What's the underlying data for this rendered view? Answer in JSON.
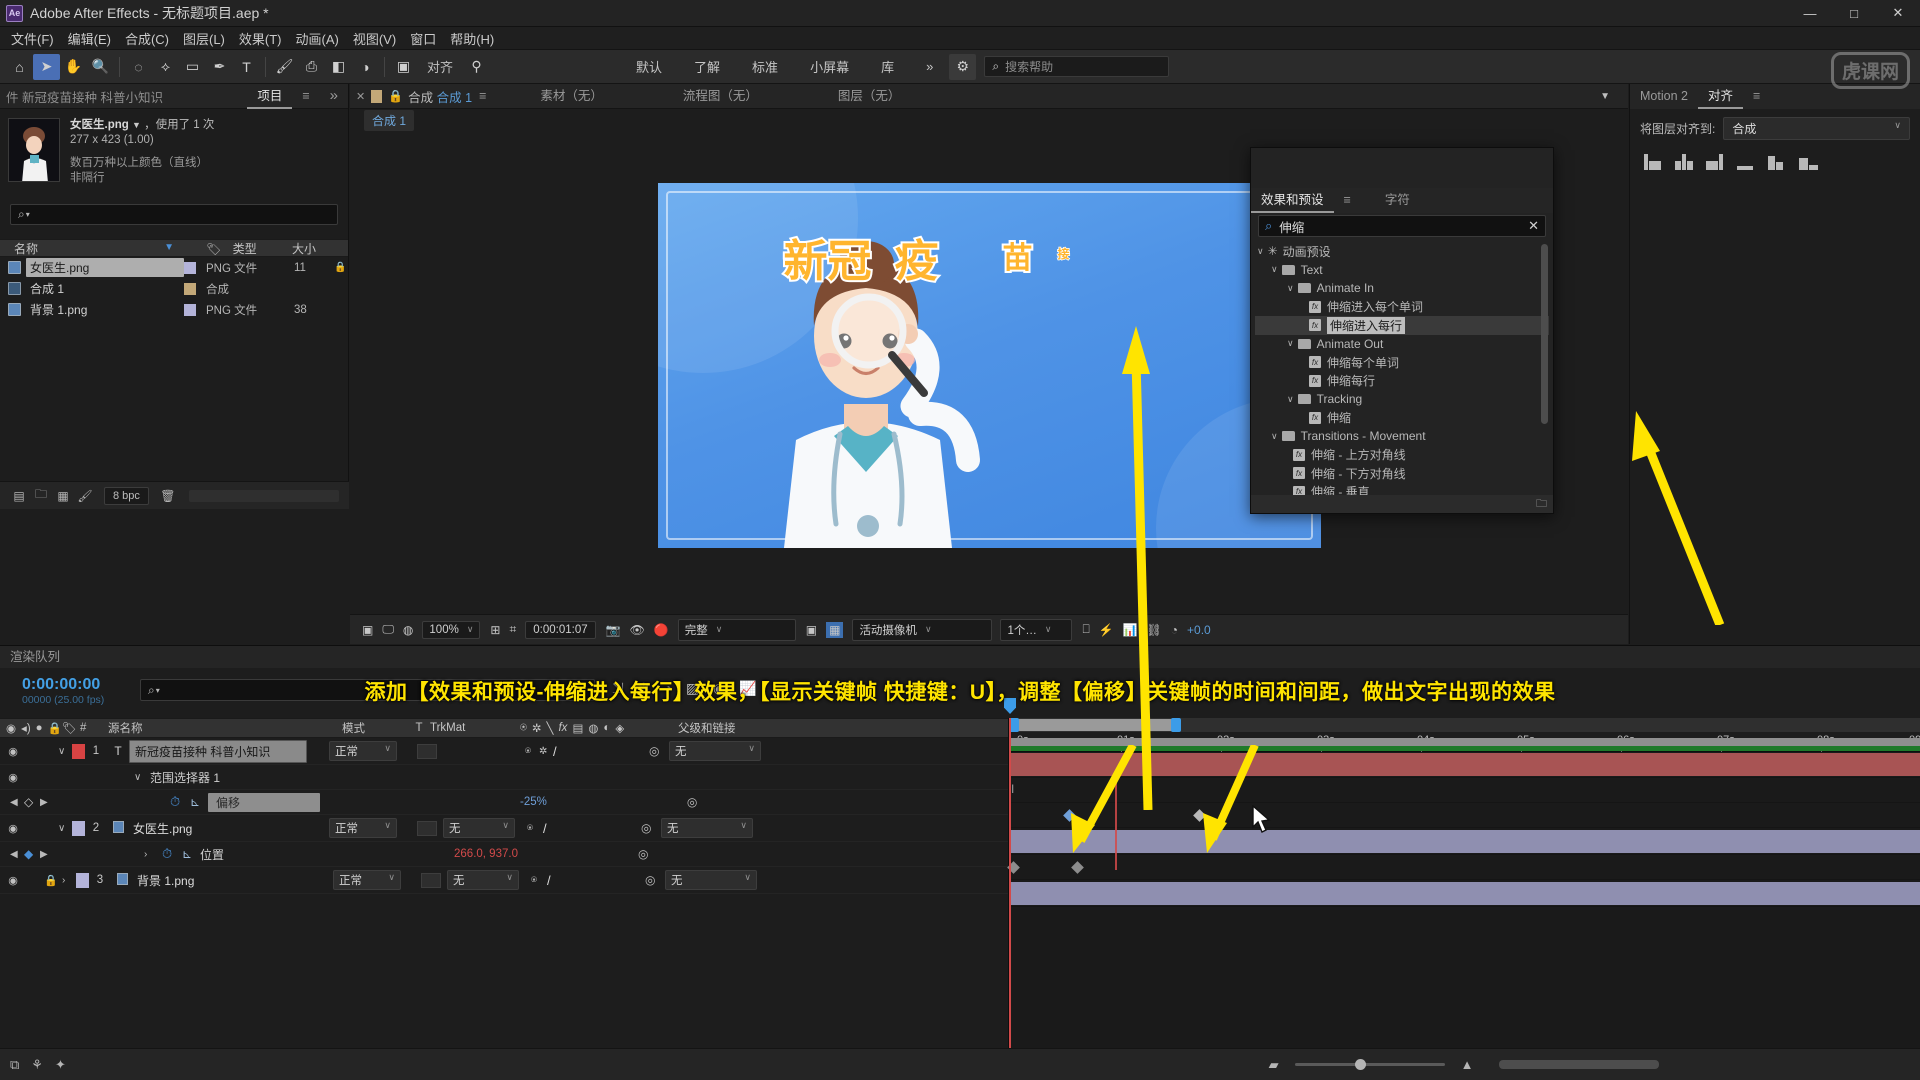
{
  "titlebar": {
    "logo": "Ae",
    "title": "Adobe After Effects - 无标题项目.aep *",
    "minimize": "—",
    "maximize": "□",
    "close": "✕"
  },
  "menubar": {
    "items": [
      "文件(F)",
      "编辑(E)",
      "合成(C)",
      "图层(L)",
      "效果(T)",
      "动画(A)",
      "视图(V)",
      "窗口",
      "帮助(H)"
    ]
  },
  "toolbar": {
    "align_label": "对齐",
    "workspaces": [
      "默认",
      "了解",
      "标准",
      "小屏幕",
      "库"
    ],
    "overflow": "»",
    "help_placeholder": "搜索帮助"
  },
  "project": {
    "tab_inactive": "件 新冠疫苗接种 科普小知识",
    "tab_active": "项目",
    "menu_icon": "≡",
    "expand_icon": "»",
    "selected_item": {
      "filename": "女医生.png",
      "used_text": "，使用了 1 次",
      "dimensions": "277 x 423 (1.00)",
      "color_depth": "数百万种以上颜色（直线）",
      "interlace": "非隔行"
    },
    "search_placeholder": "",
    "columns": [
      "名称",
      "类型",
      "大小"
    ],
    "files": [
      {
        "name": "女医生.png",
        "type": "PNG 文件",
        "size": "11",
        "swatch": "#b3b3d9",
        "kind": "image",
        "selected": true
      },
      {
        "name": "合成 1",
        "type": "合成",
        "size": "",
        "swatch": "#c3a878",
        "kind": "comp",
        "selected": false
      },
      {
        "name": "背景 1.png",
        "type": "PNG 文件",
        "size": "38",
        "swatch": "#b3b3d9",
        "kind": "image",
        "selected": false
      }
    ],
    "footer": {
      "bpc": "8 bpc"
    }
  },
  "composition": {
    "tabs": [
      {
        "label": "合成 合成 1",
        "active": true
      },
      {
        "label": "素材（无）",
        "active": false
      },
      {
        "label": "流程图（无）",
        "active": false
      },
      {
        "label": "图层（无）",
        "active": false
      }
    ],
    "breadcrumb_prefix": "合成 ",
    "breadcrumb_name": "合成 1",
    "chip": "合成 1",
    "canvas_text": [
      "新冠",
      "疫",
      "苗",
      "接"
    ],
    "bottom_bar": {
      "zoom": "100%",
      "timecode": "0:00:01:07",
      "quality": "完整",
      "camera": "活动摄像机",
      "views": "1个…",
      "exposure": "+0.0"
    }
  },
  "align_panel": {
    "tab_inactive": "Motion 2",
    "tab_active": "对齐",
    "menu_icon": "≡",
    "align_to_label": "将图层对齐到:",
    "align_to_value": "合成"
  },
  "effects_panel": {
    "tab_active": "效果和预设",
    "menu_icon": "≡",
    "tab_inactive": "字符",
    "search_value": "伸缩",
    "clear_icon": "✕",
    "tree": [
      {
        "indent": 0,
        "label": "动画预设",
        "type": "root",
        "caret": "∨",
        "star": "*"
      },
      {
        "indent": 1,
        "label": "Text",
        "type": "folder",
        "caret": "∨"
      },
      {
        "indent": 2,
        "label": "Animate In",
        "type": "folder",
        "caret": "∨"
      },
      {
        "indent": 3,
        "label": "伸缩进入每个单词",
        "type": "preset"
      },
      {
        "indent": 3,
        "label": "伸缩进入每行",
        "type": "preset",
        "selected": true
      },
      {
        "indent": 2,
        "label": "Animate Out",
        "type": "folder",
        "caret": "∨"
      },
      {
        "indent": 3,
        "label": "伸缩每个单词",
        "type": "preset"
      },
      {
        "indent": 3,
        "label": "伸缩每行",
        "type": "preset"
      },
      {
        "indent": 2,
        "label": "Tracking",
        "type": "folder",
        "caret": "∨"
      },
      {
        "indent": 3,
        "label": "伸缩",
        "type": "preset"
      },
      {
        "indent": 1,
        "label": "Transitions - Movement",
        "type": "folder",
        "caret": "∨"
      },
      {
        "indent": 2,
        "label": "伸缩 - 上方对角线",
        "type": "preset"
      },
      {
        "indent": 2,
        "label": "伸缩 - 下方对角线",
        "type": "preset"
      },
      {
        "indent": 2,
        "label": "伸缩 - 垂直",
        "type": "preset"
      }
    ]
  },
  "timeline": {
    "tab_label": "渲染队列",
    "current_time": "0:00:00:00",
    "frame_info": "00000 (25.00 fps)",
    "search_placeholder": "",
    "columns": {
      "number": "#",
      "source_name": "源名称",
      "mode": "模式",
      "t": "T",
      "trkmat": "TrkMat",
      "parent": "父级和链接"
    },
    "layers": [
      {
        "index": "1",
        "name": "新冠疫苗接种 科普小知识",
        "type": "text",
        "mode": "正常",
        "trkmat": "",
        "parent": "无",
        "color": "#d84343",
        "name_boxed": true,
        "locked": false,
        "expanded": true
      },
      {
        "index": "2",
        "name": "女医生.png",
        "type": "image",
        "mode": "正常",
        "trkmat": "无",
        "parent": "无",
        "color": "#b3b3d9",
        "name_boxed": false,
        "locked": false,
        "expanded": true
      },
      {
        "index": "3",
        "name": "背景 1.png",
        "type": "image",
        "mode": "正常",
        "trkmat": "无",
        "parent": "无",
        "color": "#b3b3d9",
        "name_boxed": false,
        "locked": true,
        "expanded": false
      }
    ],
    "properties": [
      {
        "owner": 1,
        "label": "范围选择器 1",
        "value": "",
        "depth": 1,
        "kind": "group"
      },
      {
        "owner": 1,
        "label": "偏移",
        "value": "-25%",
        "value_color": "#6f9fd8",
        "depth": 2,
        "kind": "anim",
        "boxed": true
      },
      {
        "owner": 2,
        "label": "位置",
        "value": "266.0, 937.0",
        "value_color": "#d24a4a",
        "depth": 2,
        "kind": "anim",
        "boxed": false
      }
    ],
    "ruler_ticks": [
      "0s",
      "01s",
      "02s",
      "03s",
      "04s",
      "05s",
      "06s",
      "07s",
      "08s",
      "09"
    ],
    "keyframes": {
      "offset": [
        "00:22",
        "02:10"
      ],
      "position": [
        "0s",
        "00:18"
      ]
    }
  },
  "annotation": {
    "text": "添加【效果和预设-伸缩进入每行】效果，【显示关键帧 快捷键：U】，调整【偏移】关键帧的时间和间距，做出文字出现的效果",
    "color": "#ffe400"
  },
  "watermark": {
    "text": "虎课网"
  },
  "colors": {
    "accent_blue": "#3c9ce8",
    "annotation_yellow": "#ffe400",
    "arrow_yellow": "#ffe400",
    "panel_bg": "#1d1d1d",
    "selected_blue": "#4a6fb5",
    "comp_tan": "#c3a878"
  }
}
